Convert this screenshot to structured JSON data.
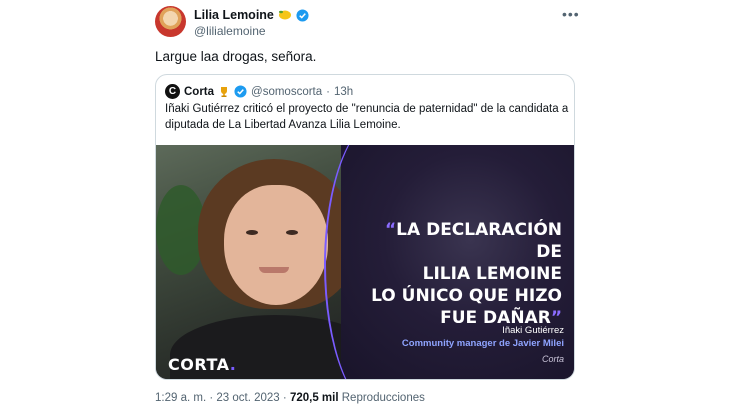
{
  "author": {
    "name": "Lilia Lemoine",
    "handle": "@lilialemoine"
  },
  "tweet": {
    "text": "Largue laa drogas, señora."
  },
  "quoted": {
    "name": "Corta",
    "handle": "@somoscorta",
    "separator": "·",
    "time": "13h",
    "avatar_letter": "C",
    "text": "Iñaki Gutiérrez criticó el proyecto de \"renuncia de paternidad\" de la candidata a diputada de La Libertad Avanza Lilia Lemoine.",
    "media": {
      "quote_line1": "LA DECLARACIÓN DE",
      "quote_line2": "LILIA LEMOINE",
      "quote_line3": "LO ÚNICO QUE HIZO",
      "quote_line4": "FUE DAÑAR",
      "open_quote": "“",
      "close_quote": "”",
      "attribution_name": "Iñaki Gutiérrez",
      "attribution_role": "Community manager de Javier Milei",
      "source": "Corta",
      "logo": "CORTA",
      "logo_dot": "."
    }
  },
  "meta": {
    "time": "1:29 a. m.",
    "separator1": "·",
    "date": "23 oct. 2023",
    "separator2": "·",
    "views_count": "720,5 mil",
    "views_label": "Reproducciones"
  },
  "colors": {
    "verified": "#1d9bf0",
    "accent_purple": "#7a5cff",
    "text_secondary": "#536471"
  }
}
